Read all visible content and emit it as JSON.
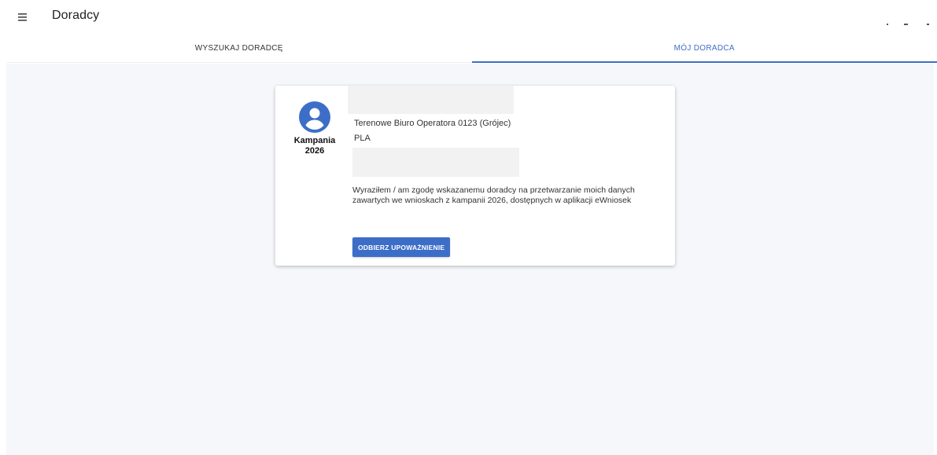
{
  "appbar": {
    "title": "Doradcy",
    "menu_icon": "hamburger-menu-icon"
  },
  "tabs": [
    {
      "label": "WYSZUKAJ DORADCĘ",
      "active": false
    },
    {
      "label": "MÓJ DORADCA",
      "active": true
    }
  ],
  "colors": {
    "accent": "#3d6ec7",
    "content_background": "#f5f7fa",
    "redaction": "#f2f2f2"
  },
  "advisor_card": {
    "campaign_icon": "account-circle-icon",
    "campaign_label": "Kampania 2026",
    "office": "Terenowe Biuro Operatora 0123 (Grójec)",
    "country": "PLA",
    "consent_text": "Wyraziłem / am zgodę wskazanemu doradcy na przetwarzanie moich danych zawartych we wnioskach z kampanii 2026, dostępnych w aplikacji eWniosek",
    "revoke_button_label": "ODBIERZ UPOWAŻNIENIE"
  }
}
